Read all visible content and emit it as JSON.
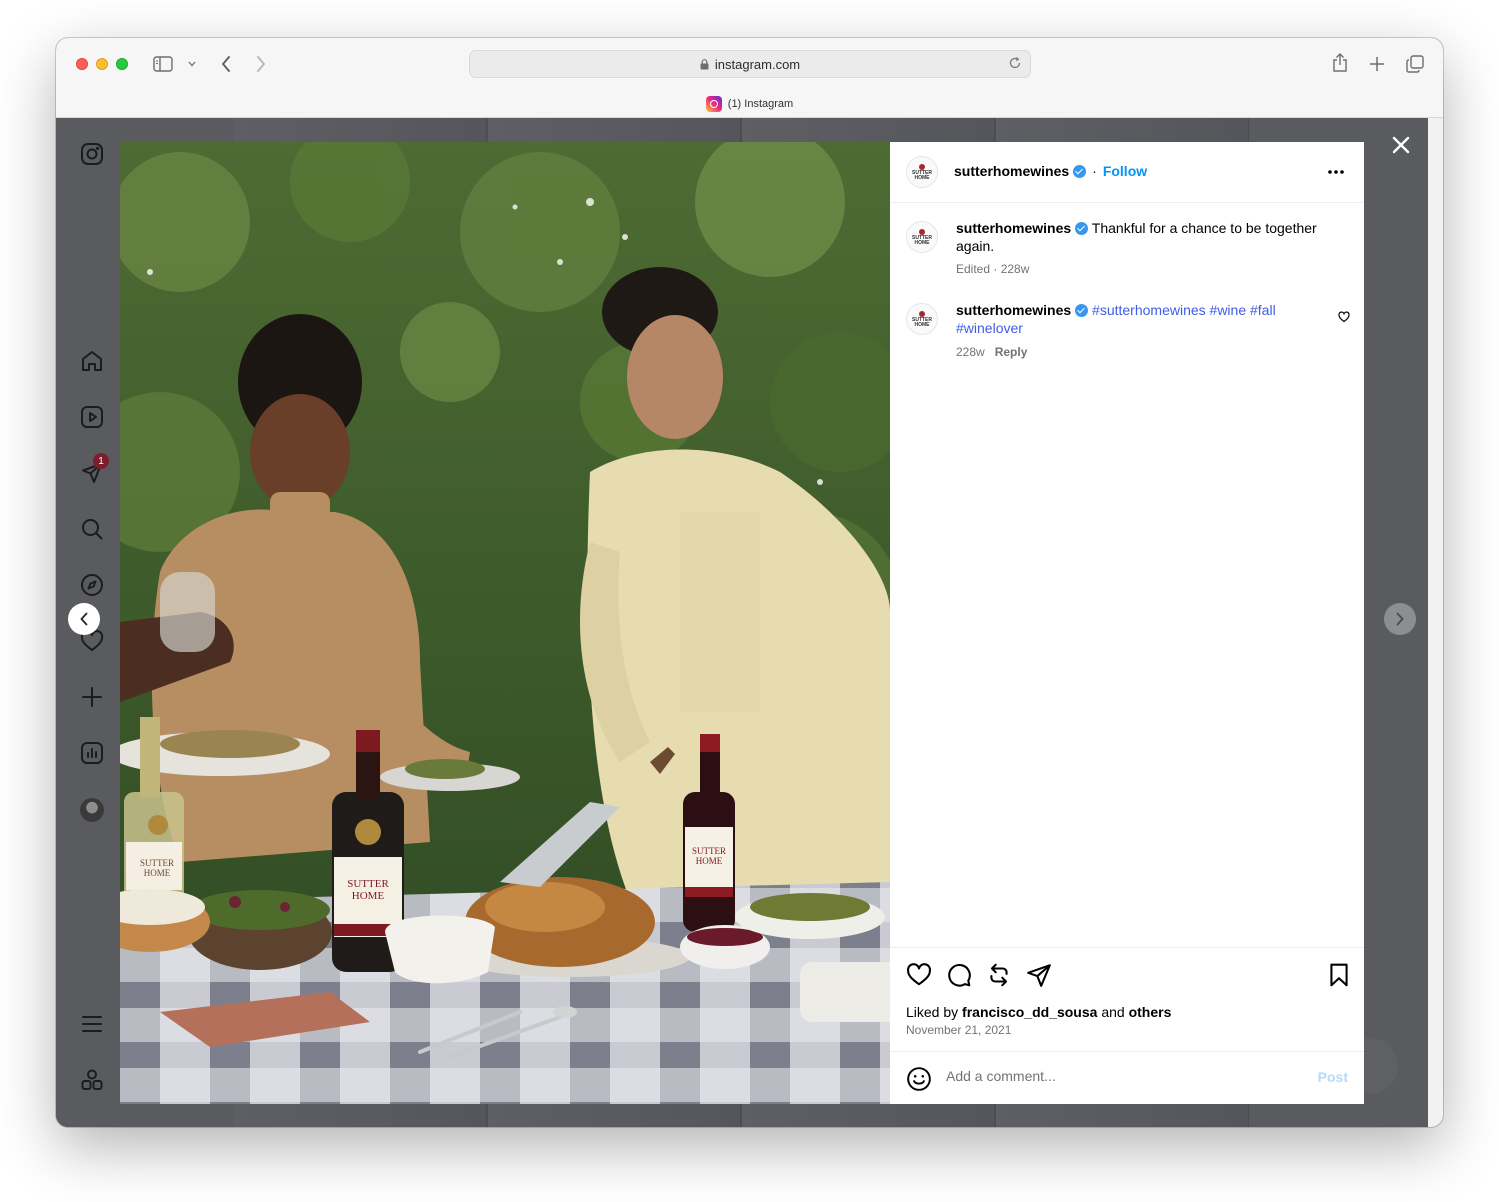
{
  "browser": {
    "url": "instagram.com",
    "tab_title": "(1) Instagram"
  },
  "sidebar": {
    "notification_count": "1",
    "icons": [
      "instagram-icon",
      "home-icon",
      "reels-icon",
      "messages-icon",
      "search-icon",
      "explore-icon",
      "heart-icon",
      "create-icon",
      "insights-icon",
      "profile-avatar",
      "menu-icon",
      "more-apps-icon"
    ]
  },
  "post": {
    "photo_description_icon": "photo",
    "author": {
      "username": "sutterhomewines",
      "verified": true,
      "follow_label": "Follow",
      "logo_line1": "SUTTER",
      "logo_line2": "HOME"
    },
    "caption": {
      "username": "sutterhomewines",
      "text": "Thankful for a chance to be together again.",
      "meta": "Edited · 228w"
    },
    "comments": [
      {
        "username": "sutterhomewines",
        "hashtags": "#sutterhomewines #wine #fall #winelover",
        "time": "228w",
        "reply_label": "Reply"
      }
    ],
    "likes_prefix": "Liked by",
    "likes_user": "francisco_dd_sousa",
    "likes_and": "and",
    "likes_others": "others",
    "date": "November 21, 2021",
    "add_comment_placeholder": "Add a comment...",
    "post_label": "Post"
  },
  "colors": {
    "accent": "#0095f6",
    "verified": "#3797f0",
    "hashtag": "#3d5de8",
    "overlay": "#595b5f"
  }
}
